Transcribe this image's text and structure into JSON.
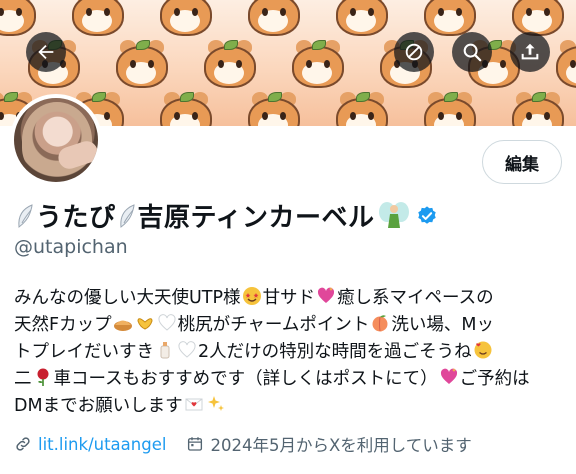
{
  "colors": {
    "accent": "#1d9bf0",
    "text": "#0f1419",
    "secondary": "#536471",
    "border": "#cfd9de"
  },
  "header": {
    "back_icon": "arrow-left-icon",
    "action_icons": [
      "no-notify-icon",
      "search-icon",
      "share-icon"
    ]
  },
  "profile": {
    "edit_label": "編集",
    "name_part1": "うたぴ",
    "name_part2": "吉原ティンカーベル",
    "name_emoji": "fairy",
    "verified_icon": "verified-badge-icon",
    "handle": "@utapichan",
    "bio_lines": [
      [
        "みんなの優しい大天使UTP様",
        "甘サド",
        "癒し系マイペースの"
      ],
      [
        "天然Fカップ",
        "桃尻がチャームポイント",
        "洗い場、Mッ"
      ],
      [
        "トプレイだいすき",
        "2人だけの特別な時間を過ごそうね"
      ],
      [
        "二",
        "車コースもおすすめです（詳しくはポストにて）",
        "ご予約は"
      ],
      [
        "DMまでお願いします"
      ]
    ],
    "link_text": "lit.link/utaangel",
    "joined_text": "2024年5月からXを利用しています"
  }
}
